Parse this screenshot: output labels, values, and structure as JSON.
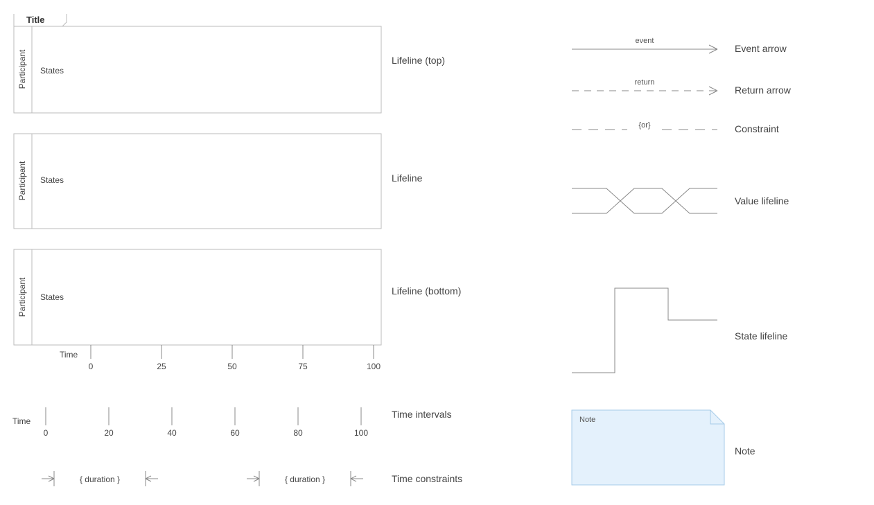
{
  "shapes": {
    "lifeline_top": {
      "title_tab": "Title",
      "participant_label": "Participant",
      "states_label": "States",
      "caption": "Lifeline (top)"
    },
    "lifeline": {
      "participant_label": "Participant",
      "states_label": "States",
      "caption": "Lifeline"
    },
    "lifeline_bottom": {
      "participant_label": "Participant",
      "states_label": "States",
      "time_label": "Time",
      "ticks": [
        "0",
        "25",
        "50",
        "75",
        "100"
      ],
      "caption": "Lifeline (bottom)"
    },
    "time_intervals": {
      "time_label": "Time",
      "ticks": [
        "0",
        "20",
        "40",
        "60",
        "80",
        "100"
      ],
      "caption": "Time intervals"
    },
    "time_constraints": {
      "duration1": "{ duration }",
      "duration2": "{ duration }",
      "caption": "Time constraints"
    },
    "event_arrow": {
      "label": "event",
      "caption": "Event arrow"
    },
    "return_arrow": {
      "label": "return",
      "caption": "Return arrow"
    },
    "constraint": {
      "label": "{or}",
      "caption": "Constraint"
    },
    "value_lifeline": {
      "caption": "Value lifeline"
    },
    "state_lifeline": {
      "caption": "State lifeline"
    },
    "note": {
      "text": "Note",
      "caption": "Note"
    }
  }
}
